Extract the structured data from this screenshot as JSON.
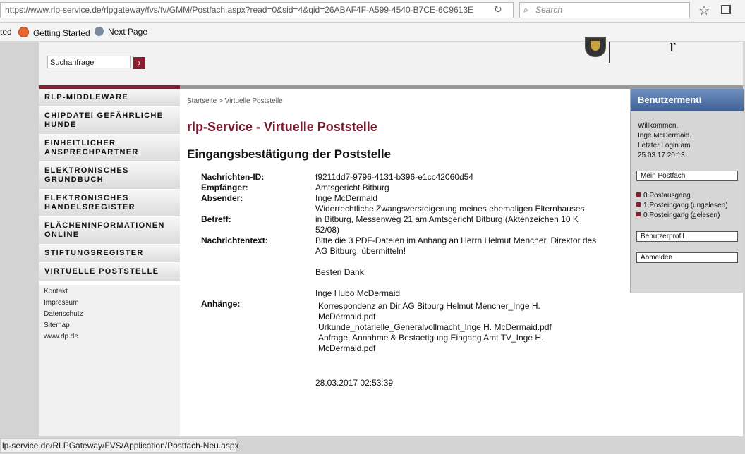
{
  "browser": {
    "url_domain": "https://www.rlp-service.de",
    "url_path": "/rlpgateway/fvs/fv/GMM/Postfach.aspx?read=0&sid=4&qid=26ABAF4F-A599-4540-B7CE-6C9613E",
    "search_placeholder": "Search",
    "bookmarks": [
      "ted",
      "Getting Started",
      "Next Page"
    ],
    "status_url": "lp-service.de/RLPGateway/FVS/Application/Postfach-Neu.aspx"
  },
  "header": {
    "search_value": "Suchanfrage",
    "search_button": "›",
    "logo_char": "r"
  },
  "nav": {
    "items": [
      "RLP-MIDDLEWARE",
      "CHIPDATEI GEFÄHRLICHE HUNDE",
      "EINHEITLICHER ANSPRECHPARTNER",
      "ELEKTRONISCHES GRUNDBUCH",
      "ELEKTRONISCHES HANDELSREGISTER",
      "FLÄCHENINFORMATIONEN ONLINE",
      "STIFTUNGSREGISTER",
      "VIRTUELLE POSTSTELLE"
    ],
    "footer_links": [
      "Kontakt",
      "Impressum",
      "Datenschutz",
      "Sitemap",
      "www.rlp.de"
    ]
  },
  "breadcrumb": {
    "home": "Startseite",
    "sep": " > ",
    "current": "Virtuelle Poststelle"
  },
  "main": {
    "title": "rlp-Service - Virtuelle Poststelle",
    "subtitle": "Eingangsbestätigung der Poststelle",
    "labels": {
      "id": "Nachrichten-ID:",
      "recipient": "Empfänger:",
      "sender": "Absender:",
      "subject": "Betreff:",
      "text": "Nachrichtentext:",
      "attachments": "Anhänge:"
    },
    "values": {
      "id": "f9211dd7-9796-4131-b396-e1cc42060d54",
      "recipient": "Amtsgericht Bitburg",
      "sender": "Inge McDermaid",
      "subject_1": "Widerrechtliche Zwangsversteigerung meines ehemaligen Elternhauses",
      "subject_2": "in Bitburg, Messenweg 21 am Amtsgericht Bitburg (Aktenzeichen 10 K",
      "subject_3": "52/08)",
      "text_1": "Bitte die 3 PDF-Dateien im Anhang an Herrn Helmut Mencher, Direktor des",
      "text_2": "AG Bitburg, übermitteln!",
      "text_3": "Besten Dank!",
      "text_4": "Inge Hubo McDermaid",
      "date": "28.03.2017 02:53:39"
    },
    "attachments": [
      "Korrespondenz an Dir AG Bitburg Helmut Mencher_Inge H. McDermaid.pdf",
      "Urkunde_notarielle_Generalvollmacht_Inge H. McDermaid.pdf",
      "Anfrage, Annahme & Bestaetigung Eingang Amt TV_Inge H. McDermaid.pdf"
    ]
  },
  "sidebar": {
    "title": "Benutzermenü",
    "welcome_1": "Willkommen,",
    "welcome_2": "Inge McDermaid.",
    "welcome_3": "Letzter Login am",
    "welcome_4": "25.03.17 20:13.",
    "mailbox": "Mein Postfach",
    "counts": [
      "0 Postausgang",
      "1 Posteingang (ungelesen)",
      "0 Posteingang (gelesen)"
    ],
    "profile": "Benutzerprofil",
    "logout": "Abmelden"
  },
  "colors": {
    "brand": "#8a1c2f",
    "menu_head": "#4a6ba3"
  },
  "icons": [
    "reload-icon",
    "search-icon",
    "star-icon",
    "bookmarks-icon",
    "firefox-icon",
    "globe-icon",
    "crest-icon",
    "bullet-square-icon"
  ]
}
